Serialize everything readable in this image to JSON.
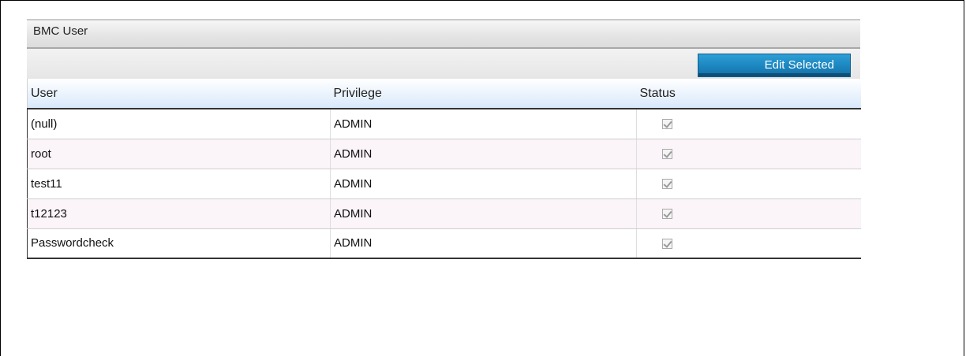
{
  "panel": {
    "title": "BMC User",
    "edit_button_label": "Edit Selected"
  },
  "table": {
    "columns": [
      "User",
      "Privilege",
      "Status"
    ],
    "rows": [
      {
        "user": "(null)",
        "privilege": "ADMIN",
        "status_checked": true
      },
      {
        "user": "root",
        "privilege": "ADMIN",
        "status_checked": true
      },
      {
        "user": "test11",
        "privilege": "ADMIN",
        "status_checked": true
      },
      {
        "user": "t12123",
        "privilege": "ADMIN",
        "status_checked": true
      },
      {
        "user": "Passwordcheck",
        "privilege": "ADMIN",
        "status_checked": true
      }
    ]
  },
  "colors": {
    "accent_button": "#1b85bf",
    "header_gradient_end": "#d8e9fb",
    "alt_row": "#fbf4f8"
  },
  "icons": {
    "status": "checkbox-checked-disabled-icon"
  }
}
